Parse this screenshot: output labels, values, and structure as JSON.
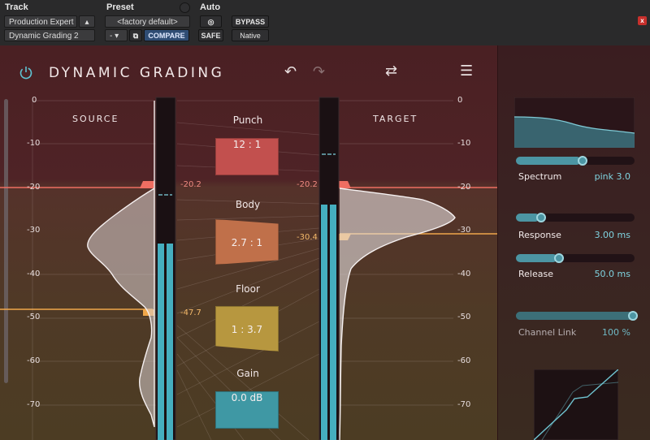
{
  "host": {
    "track_label": "Track",
    "preset_label": "Preset",
    "auto_label": "Auto",
    "track_name": "Production Expert",
    "track_insert": "Dynamic Grading 2",
    "preset_name": "<factory default>",
    "preset_minus": "-",
    "compare": "COMPARE",
    "safe": "SAFE",
    "bypass": "BYPASS",
    "native": "Native"
  },
  "plugin": {
    "title": "DYNAMIC GRADING",
    "source_label": "SOURCE",
    "target_label": "TARGET",
    "scale": [
      "0",
      "-10",
      "-20",
      "-30",
      "-40",
      "-50",
      "-60",
      "-70"
    ],
    "source_thresholds": {
      "upper": "-20.2",
      "lower": "-47.7"
    },
    "target_thresholds": {
      "upper": "-20.2",
      "lower": "-30.4"
    },
    "controls": [
      {
        "label": "Punch",
        "value": "12 : 1",
        "color": "#c2504e"
      },
      {
        "label": "Body",
        "value": "2.7 : 1",
        "color": "#c0704a"
      },
      {
        "label": "Floor",
        "value": "1 : 3.7",
        "color": "#b7973f"
      },
      {
        "label": "Gain",
        "value": "0.0 dB",
        "color": "#3f98a4"
      }
    ]
  },
  "side": {
    "spectrum": {
      "label": "Spectrum",
      "value": "pink 3.0",
      "level": 0.55
    },
    "response": {
      "label": "Response",
      "value": "3.00 ms",
      "level": 0.2
    },
    "release": {
      "label": "Release",
      "value": "50.0 ms",
      "level": 0.35
    },
    "channel_link": {
      "label": "Channel Link",
      "value": "100 %",
      "level": 1.0
    }
  },
  "colors": {
    "accent": "#4c95a3",
    "punch": "#c2504e",
    "body": "#c0704a",
    "floor": "#b7973f",
    "gain": "#3f98a4",
    "threshold_upper": "#ef6e62",
    "threshold_lower": "#f0a74a"
  }
}
